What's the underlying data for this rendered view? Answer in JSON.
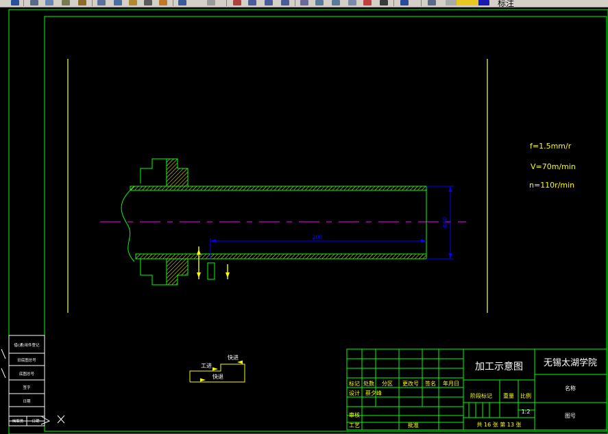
{
  "toolbar": {
    "layer_name": "标注",
    "icons": [
      "save-icon",
      "print-icon",
      "preview-icon",
      "publish-icon",
      "cut-icon",
      "copy-icon",
      "paste-icon",
      "match-properties-icon",
      "undo-icon",
      "redo-icon",
      "pan-icon",
      "zoom-realtime-icon",
      "zoom-window-icon",
      "zoom-previous-icon",
      "properties-icon",
      "design-center-icon",
      "tool-palettes-icon",
      "sheet-set-icon",
      "markup-icon",
      "calculator-icon",
      "help-icon",
      "layer-manager-icon",
      "layer-state-icons"
    ]
  },
  "drawing": {
    "params": {
      "feed": "f=1.5mm/r",
      "speed": "V=70m/min",
      "rpm": "n=110r/min"
    },
    "dim_length": "200",
    "dim_diameter": "Φ80",
    "motion": {
      "work_feed": "工进",
      "fast_forward": "快进",
      "fast_return": "快退"
    },
    "colors": {
      "border": "#00ff00",
      "hatch": "#ffff00",
      "centerline": "#ff00ff",
      "dimension": "#0000ff",
      "text": "#ffffff"
    }
  },
  "side_stamp": {
    "rows": [
      "借(通)用件登记",
      "旧底图总号",
      "底图总号",
      "签字",
      "日期"
    ],
    "bottom_cells": [
      "档案员",
      "日期"
    ]
  },
  "title_block": {
    "drawing_title": "加工示意图",
    "school": "无锡太湖学院",
    "name_label": "名称",
    "drawing_no_label": "图号",
    "headers": [
      "标记",
      "处数",
      "分区",
      "更改号",
      "签名",
      "年月日"
    ],
    "design_label": "设计",
    "designer": "蔡夕峰",
    "stage_label": "阶段标记",
    "weight_label": "重量",
    "scale_label": "比例",
    "scale": "1:2",
    "review_label": "审核",
    "process_label": "工艺",
    "approve_label": "批准",
    "sheets": "共 16 张  第 13 张"
  }
}
